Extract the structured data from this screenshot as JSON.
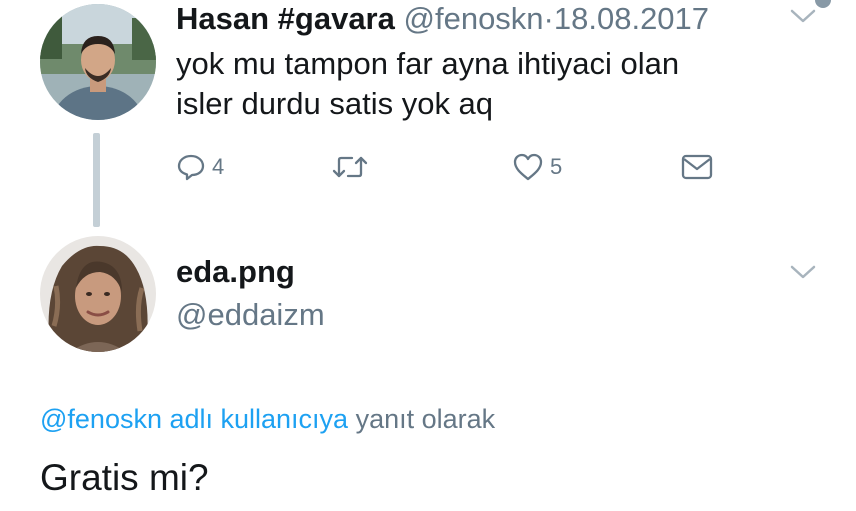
{
  "tweet1": {
    "name": "Hasan #gavara",
    "handle": "@fenoskn",
    "separator": "·",
    "date": "18.08.2017",
    "text_line1": "yok mu tampon far ayna ihtiyaci olan",
    "text_line2": "isler durdu satis yok aq",
    "reply_count": "4",
    "like_count": "5"
  },
  "tweet2": {
    "name": "eda.png",
    "handle": "@eddaizm",
    "reply_to_link": "@fenoskn adlı kullanıcıya",
    "reply_to_suffix": "yanıt olarak",
    "text": "Gratis mi?"
  },
  "icons": {
    "avatar1": "avatar-man-photo",
    "avatar2": "avatar-woman-photo",
    "reply": "reply-icon",
    "retweet": "retweet-icon",
    "like": "heart-icon",
    "dm": "envelope-icon",
    "menu": "chevron-down-icon"
  },
  "colors": {
    "text": "#14171a",
    "secondary": "#657786",
    "link": "#1da1f2",
    "thread_line": "#c4cfd6"
  }
}
